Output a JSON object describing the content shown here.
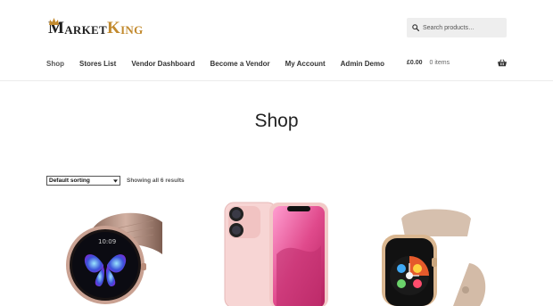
{
  "brand": {
    "m": "M",
    "arket": "ARKET",
    "k": "K",
    "ing": "ING"
  },
  "search": {
    "placeholder": "Search products…",
    "icon": "search-icon"
  },
  "nav": {
    "items": [
      {
        "label": "Shop",
        "active": true
      },
      {
        "label": "Stores List"
      },
      {
        "label": "Vendor Dashboard"
      },
      {
        "label": "Become a Vendor"
      },
      {
        "label": "My Account"
      },
      {
        "label": "Admin Demo"
      }
    ]
  },
  "cart": {
    "amount": "£0.00",
    "count": "0 items",
    "icon": "basket-icon"
  },
  "page": {
    "title": "Shop"
  },
  "toolbar": {
    "sorting_value": "Default sorting",
    "result_count": "Showing all 6 results"
  },
  "products": [
    {
      "image": "rose-gold-smartwatch-butterfly"
    },
    {
      "image": "pink-smartphone"
    },
    {
      "image": "gold-smartwatch-sand-band"
    }
  ],
  "colors": {
    "brand_accent": "#c28a2e",
    "text": "#333333",
    "search_bg": "#eeeeee"
  }
}
